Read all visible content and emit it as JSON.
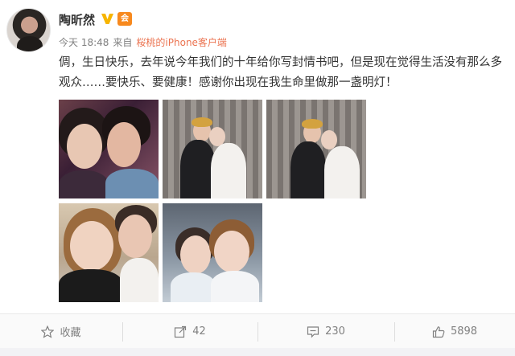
{
  "user": {
    "name": "陶昕然",
    "verified_badge": "V",
    "member_badge": "会"
  },
  "meta": {
    "time": "今天 18:48",
    "from_label": "来自",
    "source": "桜桃的iPhone客户端"
  },
  "post_text": "倜，生日快乐，去年说今年我们的十年给你写封情书吧，但是现在觉得生活没有那么多观众……要快乐、要健康！感谢你出现在我生命里做那一盏明灯！",
  "actions": {
    "favorite_label": "收藏",
    "share_count": "42",
    "comment_count": "230",
    "like_count": "5898"
  },
  "colors": {
    "source_link": "#eb7350",
    "verified": "#f7b500",
    "member_badge": "#f7891e"
  },
  "icons": [
    "star-icon",
    "share-icon",
    "comment-icon",
    "like-icon"
  ]
}
